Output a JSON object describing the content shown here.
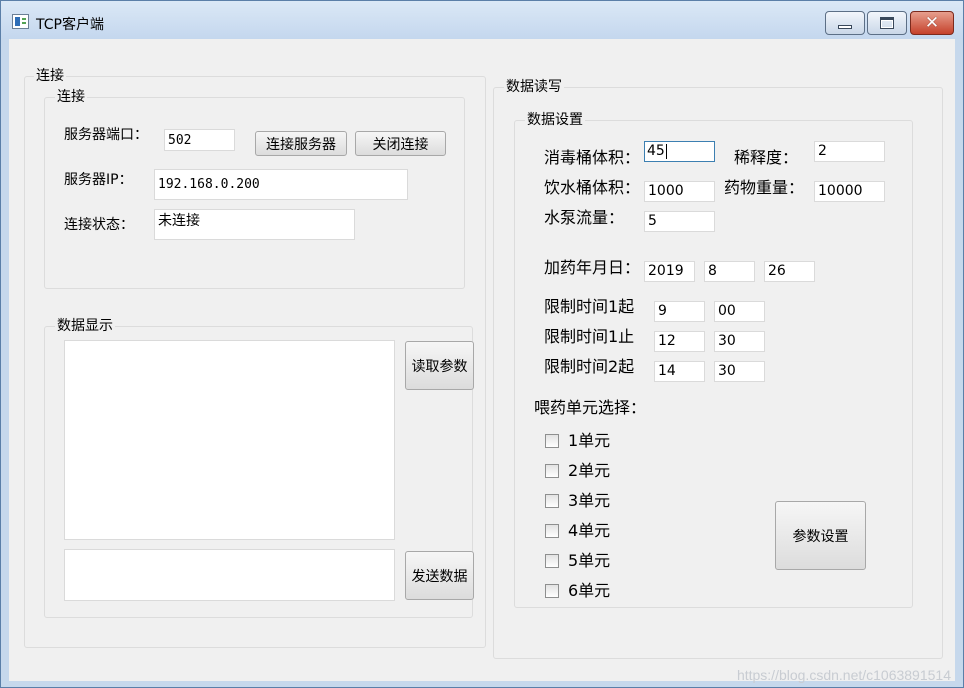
{
  "window": {
    "title": "TCP客户端"
  },
  "connection_outer": {
    "title": "连接"
  },
  "connection": {
    "title": "连接",
    "port_label": "服务器端口：",
    "port_value": "502",
    "connect_button": "连接服务器",
    "close_button": "关闭连接",
    "ip_label": "服务器IP：",
    "ip_value": "192.168.0.200",
    "status_label": "连接状态：",
    "status_value": "未连接"
  },
  "data_display": {
    "title": "数据显示",
    "read_button": "读取参数",
    "send_button": "发送数据",
    "display_text": "",
    "send_text": ""
  },
  "data_rw": {
    "title": "数据读写"
  },
  "data_settings": {
    "title": "数据设置",
    "disinfect_label": "消毒桶体积：",
    "disinfect_value": "45",
    "dilution_label": "稀释度：",
    "dilution_value": "2",
    "water_label": "饮水桶体积：",
    "water_value": "1000",
    "drug_weight_label": "药物重量：",
    "drug_weight_value": "10000",
    "pump_label": "水泵流量：",
    "pump_value": "5",
    "date_label": "加药年月日：",
    "date_year": "2019",
    "date_month": "8",
    "date_day": "26",
    "limit1_start_label": "限制时间1起",
    "limit1_start_h": "9",
    "limit1_start_m": "00",
    "limit1_end_label": "限制时间1止",
    "limit1_end_h": "12",
    "limit1_end_m": "30",
    "limit2_start_label": "限制时间2起",
    "limit2_start_h": "14",
    "limit2_start_m": "30",
    "unit_select_label": "喂药单元选择：",
    "units": [
      "1单元",
      "2单元",
      "3单元",
      "4单元",
      "5单元",
      "6单元"
    ],
    "param_button": "参数设置"
  },
  "watermark": "https://blog.csdn.net/c1063891514"
}
